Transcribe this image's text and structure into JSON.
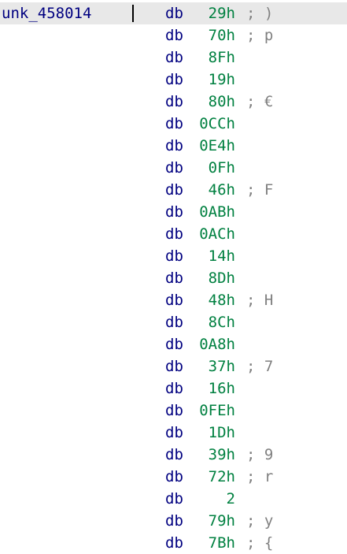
{
  "label": "unk_458014",
  "colors": {
    "label": "#000080",
    "mnemonic": "#000080",
    "operand": "#008040",
    "comment": "#808080",
    "selected_row_background": "#e8e8e8"
  },
  "rows": [
    {
      "mnemonic": "db",
      "operand": "29h",
      "comment": "; )"
    },
    {
      "mnemonic": "db",
      "operand": "70h",
      "comment": "; p"
    },
    {
      "mnemonic": "db",
      "operand": "8Fh",
      "comment": ""
    },
    {
      "mnemonic": "db",
      "operand": "19h",
      "comment": ""
    },
    {
      "mnemonic": "db",
      "operand": "80h",
      "comment": "; €"
    },
    {
      "mnemonic": "db",
      "operand": "0CCh",
      "comment": ""
    },
    {
      "mnemonic": "db",
      "operand": "0E4h",
      "comment": ""
    },
    {
      "mnemonic": "db",
      "operand": "0Fh",
      "comment": ""
    },
    {
      "mnemonic": "db",
      "operand": "46h",
      "comment": "; F"
    },
    {
      "mnemonic": "db",
      "operand": "0ABh",
      "comment": ""
    },
    {
      "mnemonic": "db",
      "operand": "0ACh",
      "comment": ""
    },
    {
      "mnemonic": "db",
      "operand": "14h",
      "comment": ""
    },
    {
      "mnemonic": "db",
      "operand": "8Dh",
      "comment": ""
    },
    {
      "mnemonic": "db",
      "operand": "48h",
      "comment": "; H"
    },
    {
      "mnemonic": "db",
      "operand": "8Ch",
      "comment": ""
    },
    {
      "mnemonic": "db",
      "operand": "0A8h",
      "comment": ""
    },
    {
      "mnemonic": "db",
      "operand": "37h",
      "comment": "; 7"
    },
    {
      "mnemonic": "db",
      "operand": "16h",
      "comment": ""
    },
    {
      "mnemonic": "db",
      "operand": "0FEh",
      "comment": ""
    },
    {
      "mnemonic": "db",
      "operand": "1Dh",
      "comment": ""
    },
    {
      "mnemonic": "db",
      "operand": "39h",
      "comment": "; 9"
    },
    {
      "mnemonic": "db",
      "operand": "72h",
      "comment": "; r"
    },
    {
      "mnemonic": "db",
      "operand": "2",
      "comment": ""
    },
    {
      "mnemonic": "db",
      "operand": "79h",
      "comment": "; y"
    },
    {
      "mnemonic": "db",
      "operand": "7Bh",
      "comment": "; {"
    }
  ]
}
